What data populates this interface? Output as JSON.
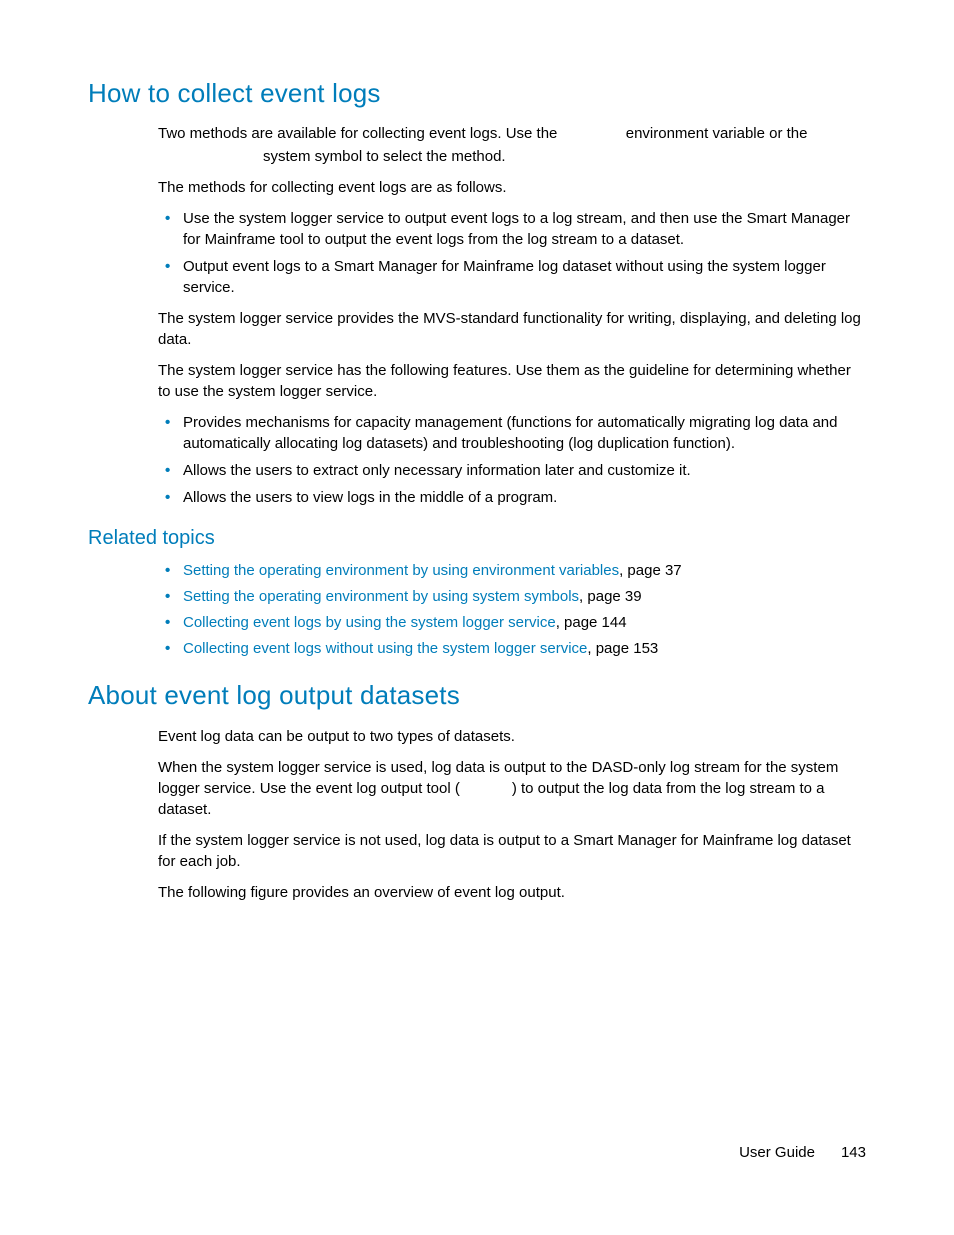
{
  "section1": {
    "title": "How to collect event logs",
    "intro_part1": "Two methods are available for collecting event logs. Use the ",
    "intro_part2": " environment variable or the ",
    "intro_line2_indent": "system symbol to select the method.",
    "p2": "The methods for collecting event logs are as follows.",
    "bullets1": [
      "Use the system logger service to output event logs to a log stream, and then use the Smart Manager for Mainframe tool to output the event logs from the log stream to a dataset.",
      "Output event logs to a Smart Manager for Mainframe log dataset without using the system logger service."
    ],
    "p3": "The system logger service provides the MVS-standard functionality for writing, displaying, and deleting log data.",
    "p4": "The system logger service has the following features. Use them as the guideline for determining whether to use the system logger service.",
    "bullets2": [
      "Provides mechanisms for capacity management (functions for automatically migrating log data and automatically allocating log datasets) and troubleshooting (log duplication function).",
      "Allows the users to extract only necessary information later and customize it.",
      "Allows the users to view logs in the middle of a program."
    ]
  },
  "related": {
    "heading": "Related topics",
    "items": [
      {
        "text": "Setting the operating environment by using environment variables",
        "suffix": ", page 37"
      },
      {
        "text": "Setting the operating environment by using system symbols",
        "suffix": ", page 39"
      },
      {
        "text": "Collecting event logs by using the system logger service",
        "suffix": ", page 144"
      },
      {
        "text": "Collecting event logs without using the system logger service",
        "suffix": ", page 153"
      }
    ]
  },
  "section2": {
    "title": "About event log output datasets",
    "p1": "Event log data can be output to two types of datasets.",
    "p2a": "When the system logger service is used, log data is output to the DASD-only log stream for the system logger service. Use the event log output tool (",
    "p2b": ") to output the log data from the log stream to a dataset.",
    "p3": "If the system logger service is not used, log data is output to a Smart Manager for Mainframe log dataset for each job.",
    "p4": "The following figure provides an overview of event log output."
  },
  "footer": {
    "label": "User Guide",
    "page": "143"
  }
}
